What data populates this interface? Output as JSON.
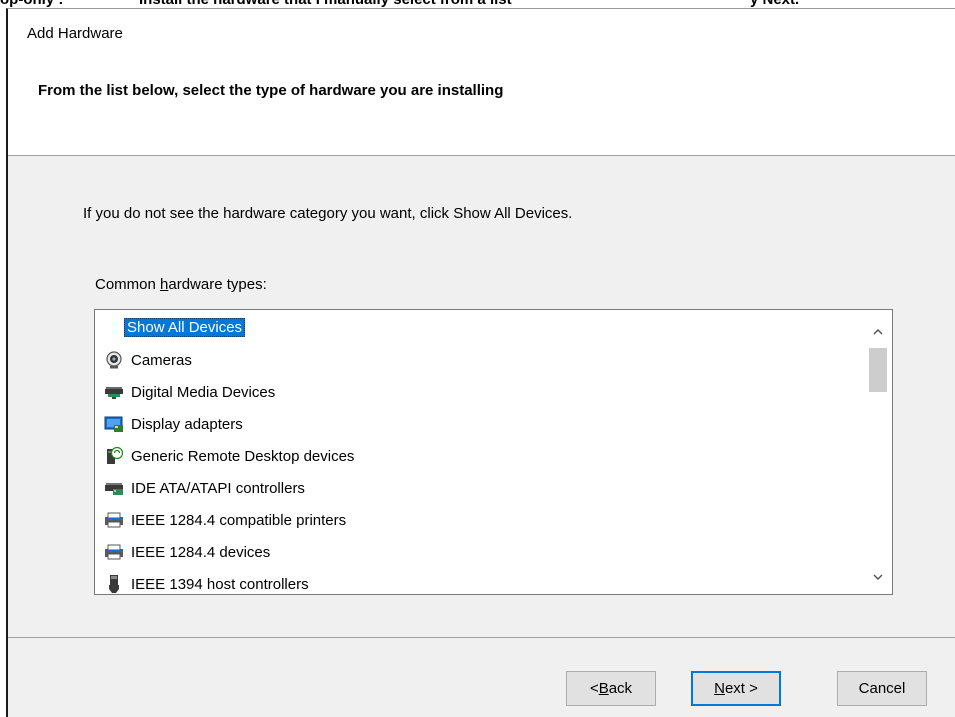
{
  "top_strip": {
    "left_fragment": "op-only :",
    "middle_fragment": "Install the hardware that I manually select from a list",
    "right_fragment": "y Next."
  },
  "dialog": {
    "title": "Add Hardware",
    "heading": "From the list below, select the type of hardware you are installing",
    "instruction": "If you do not see the hardware category you want, click Show All Devices.",
    "list_label_pre": "Common ",
    "list_label_accel": "h",
    "list_label_post": "ardware types:",
    "list_items": [
      {
        "label": "Show All Devices",
        "icon": "none",
        "selected": true
      },
      {
        "label": "Cameras",
        "icon": "camera-icon",
        "selected": false
      },
      {
        "label": "Digital Media Devices",
        "icon": "media-device-icon",
        "selected": false
      },
      {
        "label": "Display adapters",
        "icon": "display-adapter-icon",
        "selected": false
      },
      {
        "label": "Generic Remote Desktop devices",
        "icon": "remote-desktop-icon",
        "selected": false
      },
      {
        "label": "IDE ATA/ATAPI controllers",
        "icon": "ide-controller-icon",
        "selected": false
      },
      {
        "label": "IEEE 1284.4 compatible printers",
        "icon": "printer-icon",
        "selected": false
      },
      {
        "label": "IEEE 1284.4 devices",
        "icon": "printer-icon",
        "selected": false
      },
      {
        "label": "IEEE 1394 host controllers",
        "icon": "ieee1394-icon",
        "selected": false
      }
    ],
    "buttons": {
      "back_prefix": "< ",
      "back_accel": "B",
      "back_rest": "ack",
      "next_accel": "N",
      "next_rest": "ext >",
      "cancel": "Cancel"
    },
    "colors": {
      "selection": "#0078d7",
      "dialog_bg": "#f0f0f0",
      "header_bg": "#ffffff"
    }
  }
}
